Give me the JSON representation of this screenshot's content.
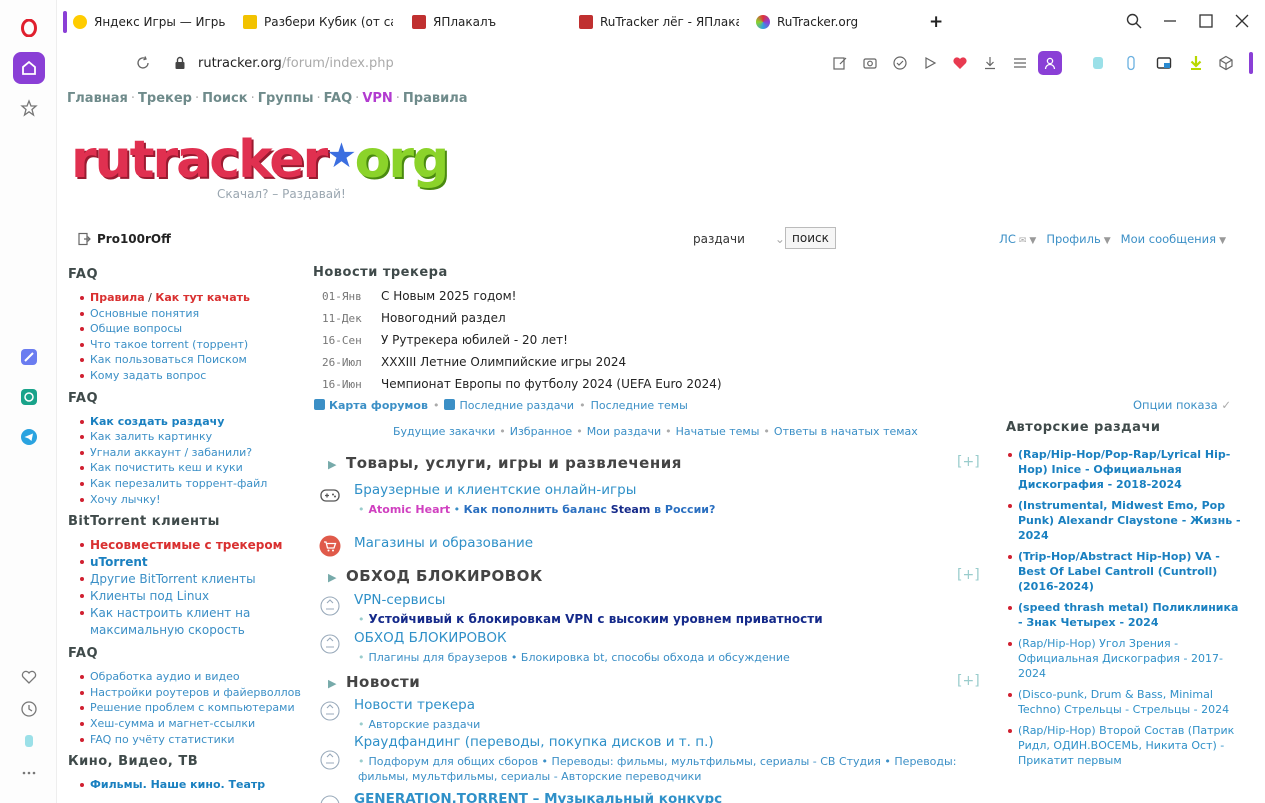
{
  "browser": {
    "tabs": [
      {
        "label": "Яндекс Игры — Игры с",
        "color": "#ffcc00"
      },
      {
        "label": "Разбери Кубик (от санк",
        "color": "#f2c200"
      },
      {
        "label": "ЯПлакалъ",
        "color": "#c03030"
      },
      {
        "label": "RuTracker лёг - ЯПлакалъ",
        "color": "#c03030"
      },
      {
        "label": "RuTracker.org",
        "color": "#8a3fd6"
      }
    ],
    "new_tab": "+",
    "url_host": "rutracker.org",
    "url_path": "/forum/index.php"
  },
  "nav": {
    "items": [
      "Главная",
      "Трекер",
      "Поиск",
      "Группы",
      "FAQ",
      "VPN",
      "Правила"
    ],
    "separator": "·"
  },
  "logo": {
    "part1": "rutracker",
    "star": "★",
    "part2": "org",
    "slogan": "Скачал? – Раздавай!"
  },
  "user": {
    "name": "Pro100rOff",
    "search_scope": "раздачи",
    "search_button": "поиск",
    "links": [
      "ЛС",
      "Профиль",
      "Мои сообщения"
    ]
  },
  "left": {
    "faq1_title": "FAQ",
    "faq1_rule": "Правила",
    "faq1_rule_sep": " / ",
    "faq1_howto": "Как тут качать",
    "faq1": [
      "Основные понятия",
      "Общие вопросы",
      "Что такое torrent (торрент)",
      "Как пользоваться Поиском",
      "Кому задать вопрос"
    ],
    "faq2_title": "FAQ",
    "faq2_first": "Как создать раздачу",
    "faq2": [
      "Как залить картинку",
      "Угнали аккаунт / забанили?",
      "Как почистить кеш и куки",
      "Как перезалить торрент-файл",
      "Хочу лычку!"
    ],
    "bt_title": "BitTorrent клиенты",
    "bt_first": "Несовместимые с трекером",
    "bt_second": "uTorrent",
    "bt": [
      "Другие BitTorrent клиенты",
      "Клиенты под Linux",
      "Как настроить клиент на максимальную скорость"
    ],
    "faq3_title": "FAQ",
    "faq3": [
      "Обработка аудио и видео",
      "Настройки роутеров и файерволлов",
      "Решение проблем с компьютерами",
      "Хеш-сумма и магнет-ссылки",
      "FAQ по учёту статистики"
    ],
    "kino_title": "Кино, Видео, ТВ",
    "kino_first": "Фильмы. Наше кино. Театр"
  },
  "news": {
    "title": "Новости трекера",
    "items": [
      {
        "date": "01-Янв",
        "text": "С Новым 2025 годом!"
      },
      {
        "date": "11-Дек",
        "text": "Новогодний раздел"
      },
      {
        "date": "16-Сен",
        "text": "У Рутрекера юбилей - 20 лет!"
      },
      {
        "date": "26-Июл",
        "text": "XXXIII Летние Олимпийские игры 2024"
      },
      {
        "date": "16-Июн",
        "text": "Чемпионат Европы по футболу 2024 (UEFA Euro 2024)"
      }
    ]
  },
  "links_row1": {
    "map": "Карта форумов",
    "recent_releases": "Последние раздачи",
    "recent_topics": "Последние темы"
  },
  "links_row2": [
    "Будущие закачки",
    "Избранное",
    "Мои раздачи",
    "Начатые темы",
    "Ответы в начатых темах"
  ],
  "options": "Опции показа",
  "categories": [
    {
      "title": "Товары, услуги, игры и развлечения",
      "plus": "[+]"
    },
    {
      "title": "ОБХОД БЛОКИРОВОК",
      "plus": "[+]"
    },
    {
      "title": "Новости",
      "plus": "[+]"
    }
  ],
  "forums": {
    "games": {
      "title": "Браузерные и клиентские онлайн-игры",
      "sub_pink": "Atomic Heart",
      "sub_sep": " • ",
      "sub_a": "Как пополнить баланс ",
      "sub_b": "Steam",
      "sub_c": " в России?"
    },
    "shops": {
      "title": "Магазины и образование"
    },
    "vpn": {
      "title": "VPN-сервисы",
      "sub": "Устойчивый к блокировкам VPN с высоким уровнем приватности"
    },
    "bypass": {
      "title": "ОБХОД БЛОКИРОВОК",
      "sub": "Плагины для браузеров • Блокировка bt, способы обхода и обсуждение"
    },
    "news_forum": {
      "title": "Новости трекера",
      "sub": "Авторские раздачи"
    },
    "crowd": {
      "title": "Краудфандинг (переводы, покупка дисков и т. п.)",
      "sub": "Подфорум для общих сборов • Переводы: фильмы, мультфильмы, сериалы - CB Студия • Переводы: фильмы, мультфильмы, сериалы - Авторские переводчики"
    },
    "cut": {
      "title": "GENERATION.TORRENT – Музыкальный конкурс"
    }
  },
  "right": {
    "title": "Авторские раздачи",
    "items": [
      {
        "text": "(Rap/Hip-Hop/Pop-Rap/Lyrical Hip-Hop) Inice - Официальная Дискография - 2018-2024",
        "bold": true
      },
      {
        "text": "(Instrumental, Midwest Emo, Pop Punk) Alexandr Claystone - Жизнь - 2024",
        "bold": true
      },
      {
        "text": "(Trip-Hop/Abstract Hip-Hop) VA - Best Of Label Cantroll (Cuntroll) (2016-2024)",
        "bold": true
      },
      {
        "text": "(speed thrash metal) Поликлиника - Знак Четырех - 2024",
        "bold": true
      },
      {
        "text": "(Rap/Hip-Hop) Угол Зрения - Официальная Дискография - 2017-2024",
        "bold": false
      },
      {
        "text": "(Disco-punk, Drum & Bass, Minimal Techno) Стрельцы - Стрельцы - 2024",
        "bold": false
      },
      {
        "text": "(Rap/Hip-Hop) Второй Состав (Патрик Ридл, ОДИН.ВОСЕМЬ, Никита Ост) - Прикатит первым",
        "bold": false
      }
    ]
  }
}
